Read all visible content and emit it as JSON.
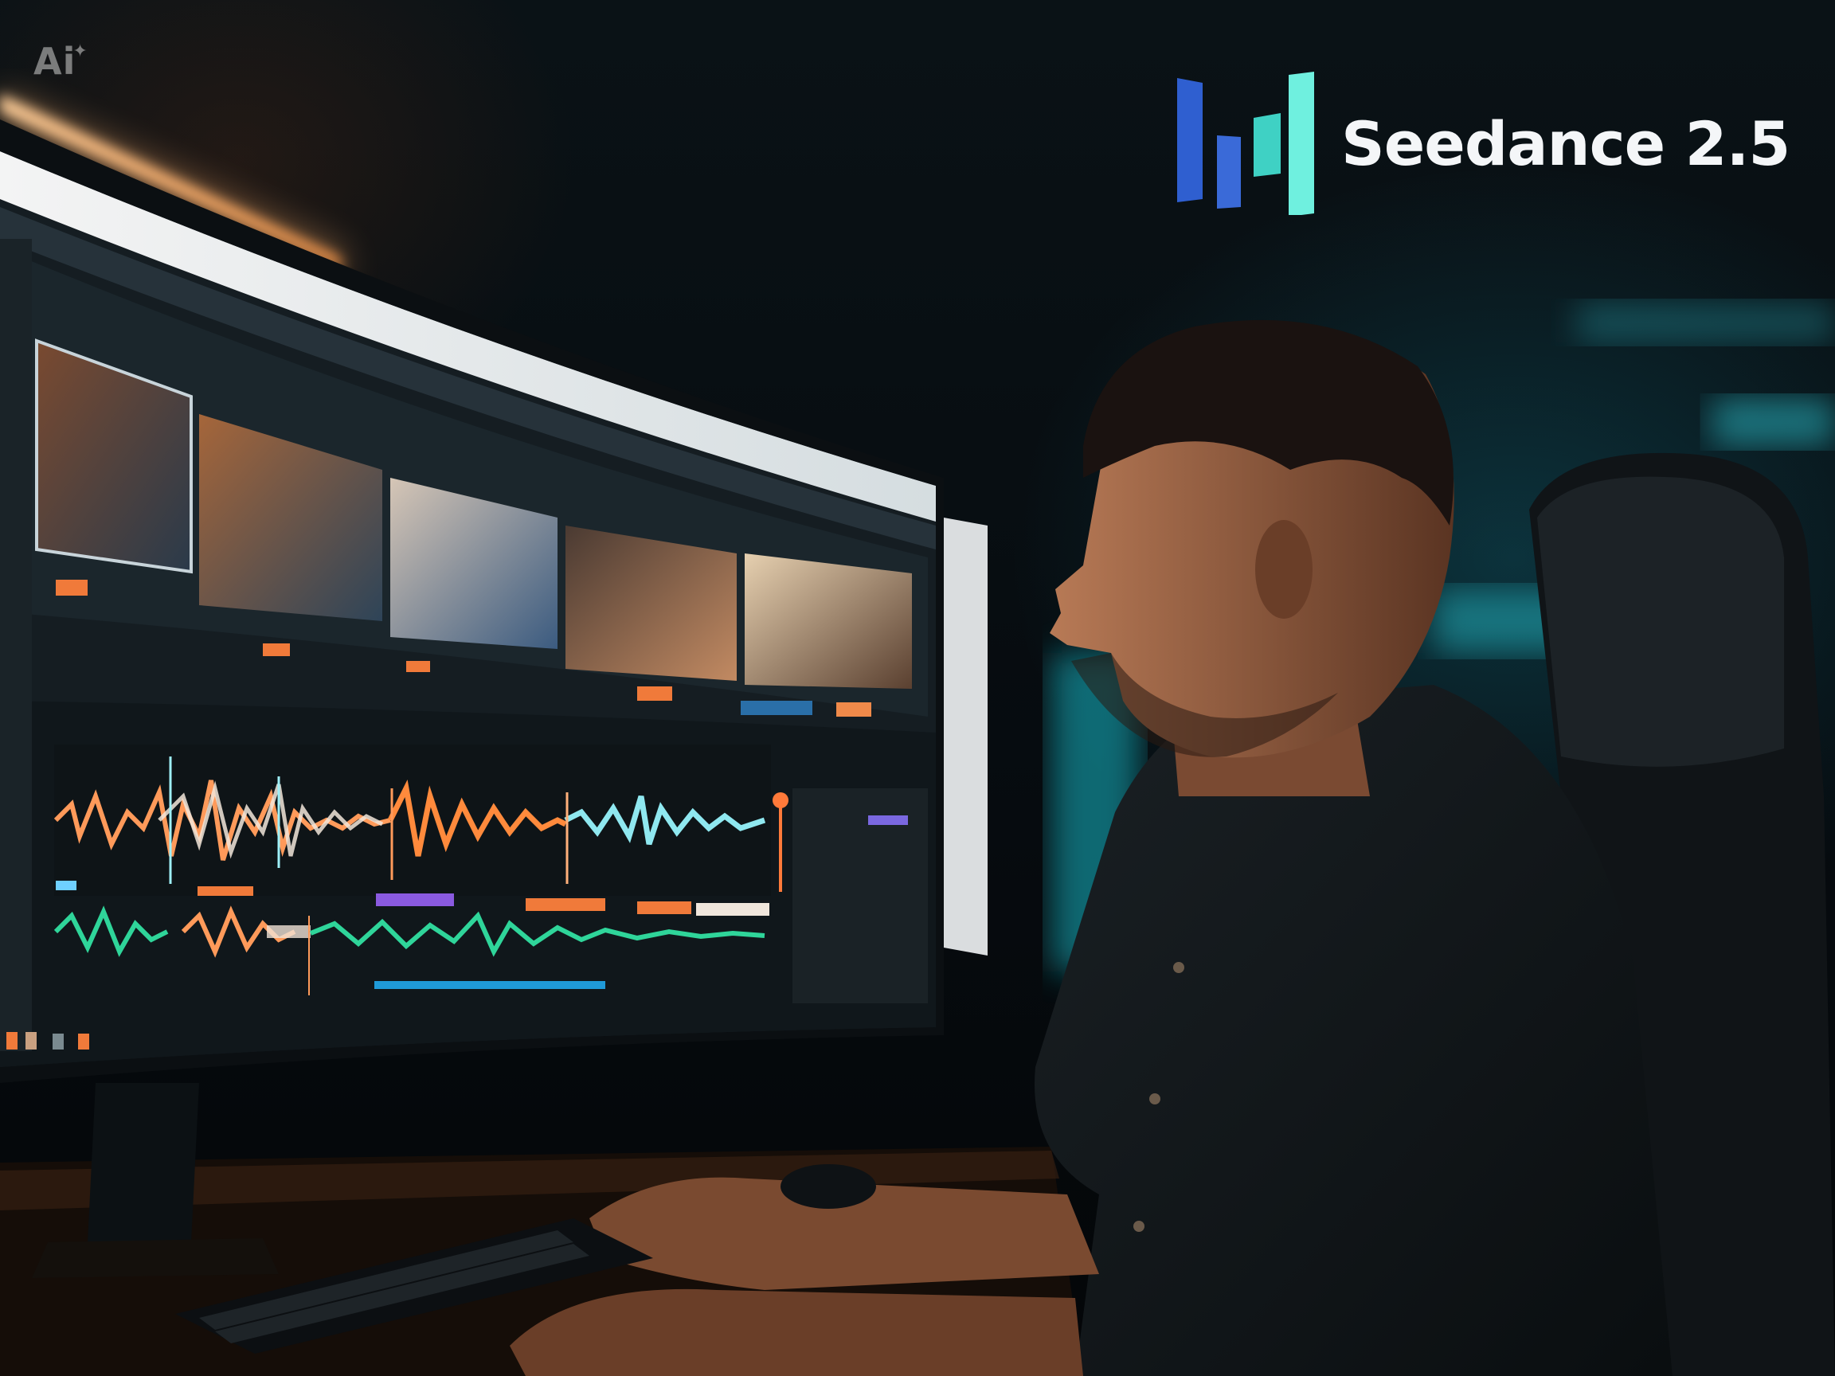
{
  "watermark": {
    "text": "Ai",
    "spark": "✦",
    "icon": "sparkle-icon"
  },
  "brand": {
    "name": "Seedance 2.5",
    "logo_icon": "bar-chart-logo-icon",
    "colors": [
      "#2f5fd0",
      "#3a7ee0",
      "#3fd1c4",
      "#6ff0df"
    ]
  },
  "scene_colors": {
    "background": "#05090d",
    "ambient_teal": "#1fb8c8",
    "lamp_orange": "#ffb46e",
    "waveform_orange": "#ff8a3c",
    "waveform_cyan": "#8fe8f0",
    "waveform_green": "#2fd59a"
  }
}
